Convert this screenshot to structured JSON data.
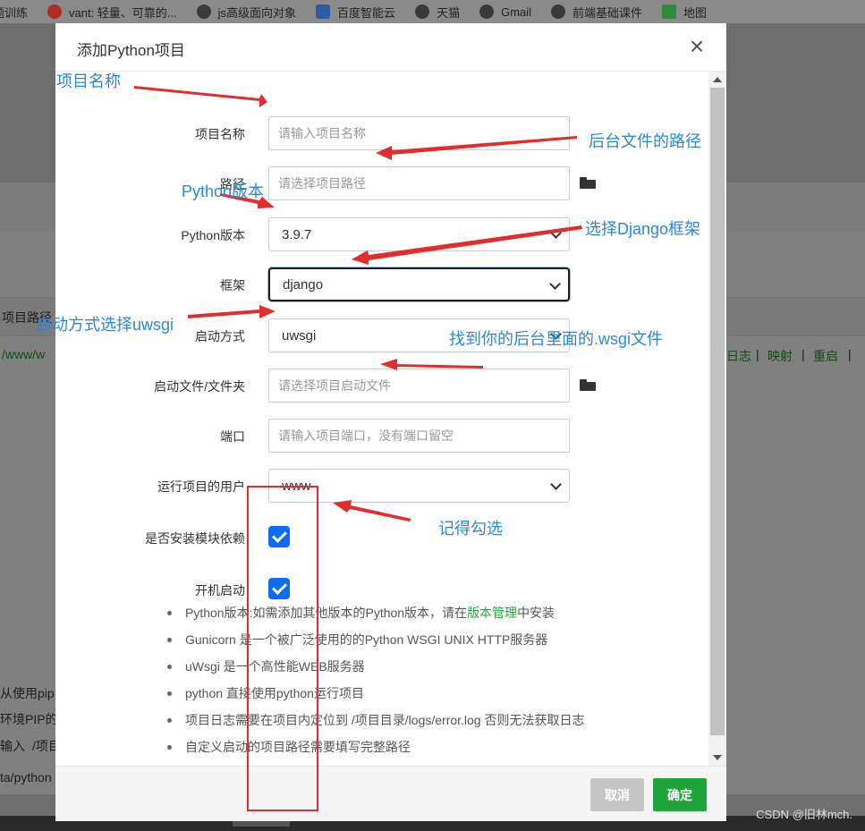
{
  "bookmarks": [
    {
      "label": "题训练",
      "icon": "bookmark-icon"
    },
    {
      "label": "vant: 轻量、可靠的...",
      "icon": "vant-icon"
    },
    {
      "label": "js高级面向对象",
      "icon": "globe-icon"
    },
    {
      "label": "百度智能云",
      "icon": "baidu-cloud-icon"
    },
    {
      "label": "天猫",
      "icon": "globe-icon"
    },
    {
      "label": "Gmail",
      "icon": "globe-icon"
    },
    {
      "label": "前端基础课件",
      "icon": "globe-icon"
    },
    {
      "label": "地图",
      "icon": "maps-icon"
    }
  ],
  "background": {
    "col_header": "项目路径",
    "path_fragment": "/www/w",
    "actions": [
      "日志",
      "映射",
      "重启"
    ],
    "line1": "从使用pip",
    "line2": "环境PIP的",
    "line3_label": "输入",
    "line3_value": "/项目",
    "line4": "ta/python"
  },
  "modal": {
    "title": "添加Python项目",
    "close": "×",
    "fields": {
      "name": {
        "label": "项目名称",
        "placeholder": "请输入项目名称"
      },
      "path": {
        "label": "路径",
        "placeholder": "请选择项目路径"
      },
      "python_version": {
        "label": "Python版本",
        "value": "3.9.7"
      },
      "framework": {
        "label": "框架",
        "value": "django"
      },
      "start_mode": {
        "label": "启动方式",
        "value": "uwsgi"
      },
      "start_file": {
        "label": "启动文件/文件夹",
        "placeholder": "请选择项目启动文件"
      },
      "port": {
        "label": "端口",
        "placeholder": "请输入项目端口，没有端口留空"
      },
      "run_user": {
        "label": "运行项目的用户",
        "value": "www"
      },
      "install_deps": {
        "label": "是否安装模块依赖",
        "checked": true
      },
      "autostart": {
        "label": "开机启动",
        "checked": true
      }
    },
    "tips": {
      "t1_pre": "Python版本:如需添加其他版本的Python版本，请在",
      "t1_link": "版本管理",
      "t1_post": "中安装",
      "t2": "Gunicorn 是一个被广泛使用的的Python WSGI UNIX HTTP服务器",
      "t3": "uWsgi 是一个高性能WEB服务器",
      "t4": "python 直接使用python运行项目",
      "t5": "项目日志需要在项目内定位到 /项目目录/logs/error.log 否则无法获取日志",
      "t6": "自定义启动的项目路径需要填写完整路径"
    },
    "buttons": {
      "cancel": "取消",
      "ok": "确定"
    }
  },
  "annotations": {
    "name": "项目名称",
    "path": "后台文件的路径",
    "python": "Python版本",
    "django": "选择Django框架",
    "uwsgi": "启动方式选择uwsgi",
    "wsgi": "找到你的后台里面的.wsgi文件",
    "remember": "记得勾选",
    "arrow_color": "#e02d2d",
    "text_color": "#2b88d8"
  },
  "watermark": "CSDN @旧林mch."
}
